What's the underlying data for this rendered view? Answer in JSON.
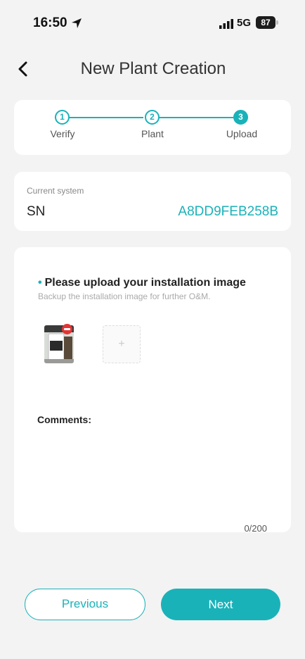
{
  "status_bar": {
    "time": "16:50",
    "location_icon": "location-arrow-icon",
    "signal_icon": "signal-bars-icon",
    "network": "5G",
    "battery": "87"
  },
  "header": {
    "back_icon": "chevron-left-icon",
    "title": "New Plant Creation"
  },
  "stepper": {
    "steps": [
      {
        "number": "1",
        "label": "Verify"
      },
      {
        "number": "2",
        "label": "Plant"
      },
      {
        "number": "3",
        "label": "Upload"
      }
    ],
    "active_step": 3
  },
  "system": {
    "caption": "Current system",
    "sn_label": "SN",
    "sn_value": "A8DD9FEB258B"
  },
  "upload": {
    "title": "Please upload your installation image",
    "required_marker": "•",
    "subtitle": "Backup the installation image for further O&M.",
    "add_icon": "plus-icon",
    "remove_icon": "remove-icon"
  },
  "comments": {
    "label": "Comments:",
    "value": "",
    "count": "0/200"
  },
  "buttons": {
    "previous": "Previous",
    "next": "Next"
  },
  "colors": {
    "accent": "#1ab2b9",
    "background": "#f3f3f3",
    "card": "#ffffff",
    "danger": "#e33535"
  }
}
